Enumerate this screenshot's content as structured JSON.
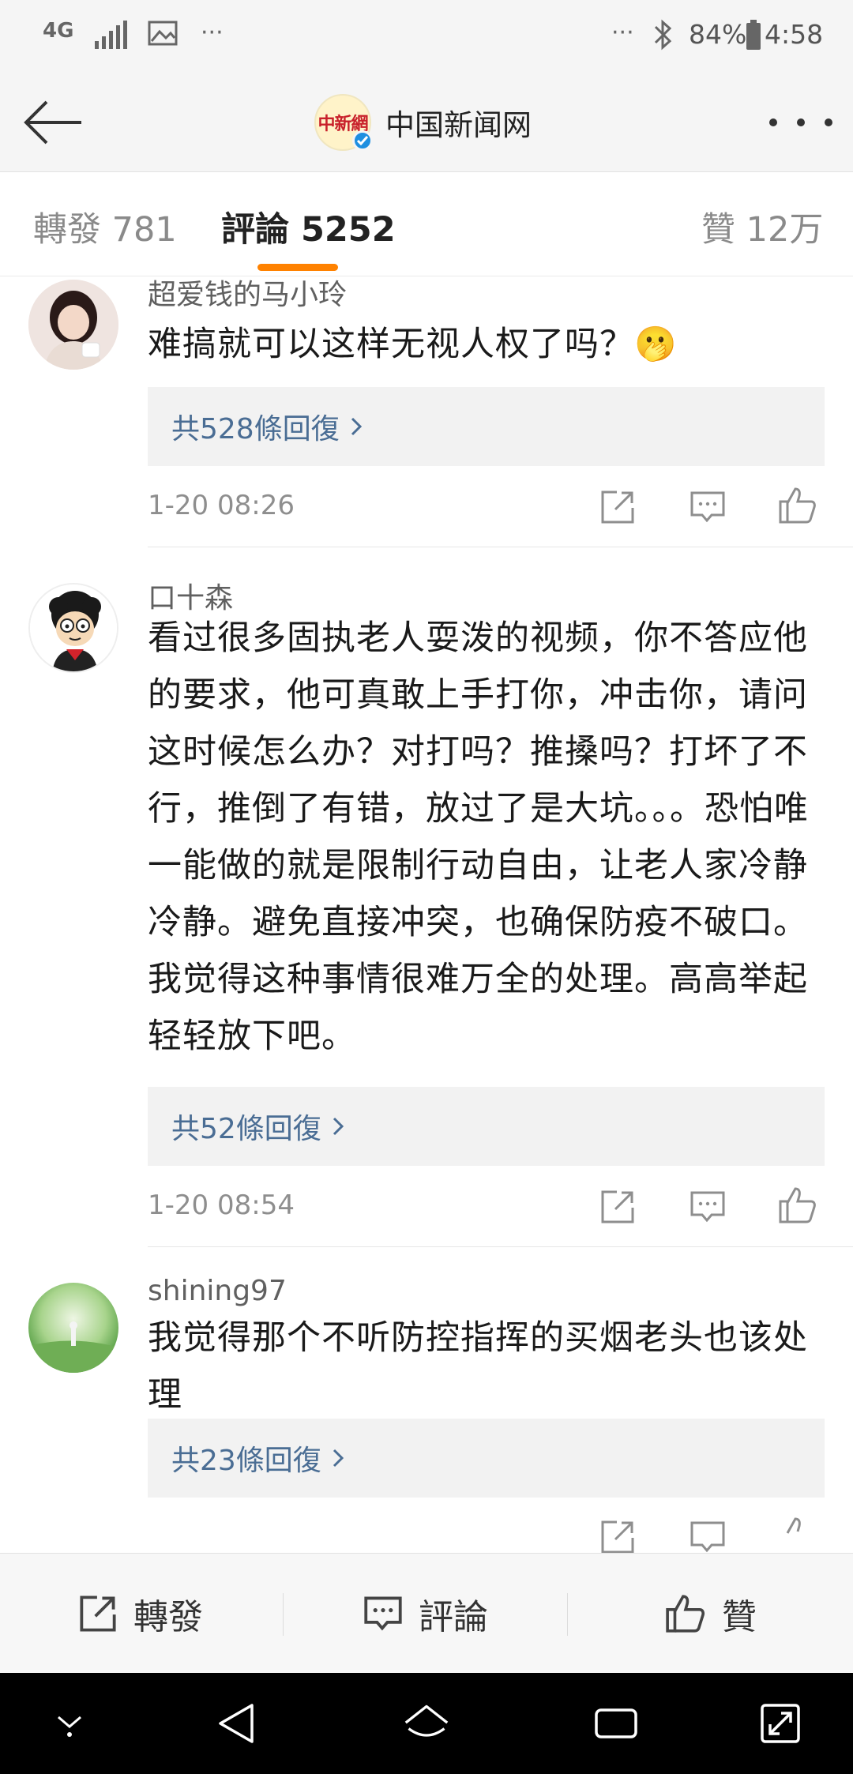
{
  "status_bar": {
    "network": "4G",
    "more": "···",
    "more_right": "···",
    "battery": "84%",
    "time": "4:58"
  },
  "header": {
    "account_name": "中国新闻网",
    "logo_text": "中新網"
  },
  "tabs": {
    "repost": "轉發 781",
    "comment": "評論 5252",
    "like": "贊 12万"
  },
  "comments": [
    {
      "user": "超爱钱的马小玲",
      "text": "难搞就可以这样无视人权了吗？🫢",
      "replies": "共528條回復",
      "time": "1-20 08:26"
    },
    {
      "user": "口十森",
      "text": "看过很多固执老人耍泼的视频，你不答应他的要求，他可真敢上手打你，冲击你，请问这时候怎么办？对打吗？推搡吗？打坏了不行，推倒了有错，放过了是大坑。。。恐怕唯一能做的就是限制行动自由，让老人家冷静冷静。避免直接冲突，也确保防疫不破口。我觉得这种事情很难万全的处理。高高举起轻轻放下吧。",
      "replies": "共52條回復",
      "time": "1-20 08:54"
    },
    {
      "user": "shining97",
      "text": "我觉得那个不听防控指挥的买烟老头也该处理",
      "replies": "共23條回復"
    }
  ],
  "bottom_bar": {
    "repost": "轉發",
    "comment": "評論",
    "like": "贊"
  },
  "colors": {
    "accent": "#ff8200",
    "link": "#4a6d94",
    "verified": "#1e8fe0"
  }
}
